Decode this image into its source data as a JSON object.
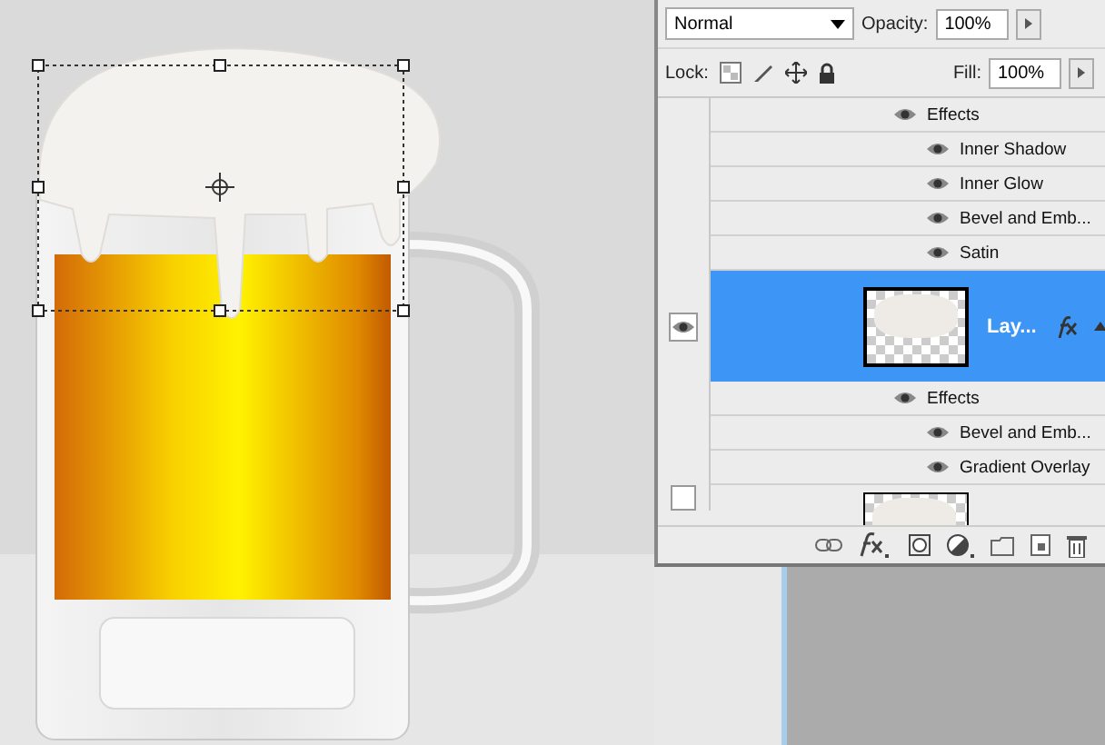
{
  "blend_mode": {
    "value": "Normal"
  },
  "opacity": {
    "label": "Opacity:",
    "value": "100%"
  },
  "lock": {
    "label": "Lock:"
  },
  "fill": {
    "label": "Fill:",
    "value": "100%"
  },
  "layers": [
    {
      "kind": "effects",
      "label": "Effects"
    },
    {
      "kind": "effect",
      "label": "Inner Shadow"
    },
    {
      "kind": "effect",
      "label": "Inner Glow"
    },
    {
      "kind": "effect",
      "label": "Bevel and Emb..."
    },
    {
      "kind": "effect",
      "label": "Satin"
    },
    {
      "kind": "layer",
      "label": "Lay...",
      "selected": true
    },
    {
      "kind": "effects",
      "label": "Effects"
    },
    {
      "kind": "effect",
      "label": "Bevel and Emb..."
    },
    {
      "kind": "effect",
      "label": "Gradient Overlay"
    },
    {
      "kind": "layer",
      "selected": false
    }
  ]
}
